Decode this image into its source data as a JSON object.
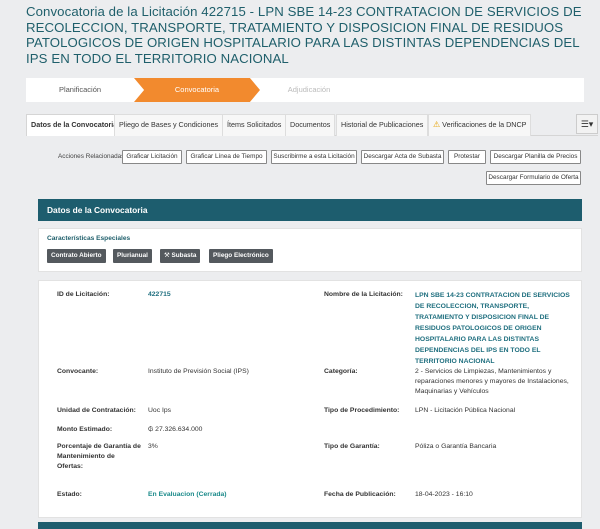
{
  "page": {
    "title": "Convocatoria de la Licitación 422715 - LPN SBE 14-23 CONTRATACION DE SERVICIOS DE RECOLECCION, TRANSPORTE, TRATAMIENTO Y DISPOSICION FINAL DE RESIDUOS PATOLOGICOS DE ORIGEN HOSPITALARIO PARA LAS DISTINTAS DEPENDENCIAS DEL IPS EN TODO EL TERRITORIO NACIONAL"
  },
  "steps": [
    {
      "label": "Planificación"
    },
    {
      "label": "Convocatoria"
    },
    {
      "label": "Adjudicación"
    }
  ],
  "tabs": [
    {
      "label": "Datos de la Convocatoria"
    },
    {
      "label": "Pliego de Bases y Condiciones"
    },
    {
      "label": "Ítems Solicitados"
    },
    {
      "label": "Documentos"
    },
    {
      "label": "Historial de Publicaciones"
    },
    {
      "label": "Verificaciones de la DNCP"
    }
  ],
  "actions": {
    "label": "Acciones Relacionadas:",
    "buttons": [
      "Graficar Licitación",
      "Graficar Línea de Tiempo",
      "Suscribirme a esta Licitación",
      "Descargar Acta de Subasta",
      "Protestar",
      "Descargar Planilla de Precios",
      "Descargar Formulario de Oferta"
    ]
  },
  "section": {
    "title": "Datos de la Convocatoria"
  },
  "especiales": {
    "title": "Características Especiales",
    "badges": [
      "Contrato Abierto",
      "Plurianual",
      "Subasta",
      "Pliego Electrónico"
    ]
  },
  "fields": {
    "id_label": "ID de Licitación:",
    "id_value": "422715",
    "nombre_label": "Nombre de la Licitación:",
    "nombre_value": "LPN SBE 14-23 CONTRATACION DE SERVICIOS DE RECOLECCION, TRANSPORTE, TRATAMIENTO Y DISPOSICION FINAL DE RESIDUOS PATOLOGICOS DE ORIGEN HOSPITALARIO PARA LAS DISTINTAS DEPENDENCIAS DEL IPS EN TODO EL TERRITORIO NACIONAL",
    "convocante_label": "Convocante:",
    "convocante_value": "Instituto de Previsión Social (IPS)",
    "categoria_label": "Categoría:",
    "categoria_value": "2 - Servicios de Limpiezas, Mantenimientos y reparaciones menores y mayores de Instalaciones, Maquinarias y Vehículos",
    "unidad_label": "Unidad de Contratación:",
    "unidad_value": "Uoc Ips",
    "tipo_proc_label": "Tipo de Procedimiento:",
    "tipo_proc_value": "LPN - Licitación Pública Nacional",
    "monto_label": "Monto Estimado:",
    "monto_value": "₲ 27.326.634.000",
    "porcentaje_label": "Porcentaje de Garantía de Mantenimiento de Ofertas:",
    "porcentaje_value": "3%",
    "tipo_gar_label": "Tipo de Garantía:",
    "tipo_gar_value": "Póliza o Garantía Bancaria",
    "estado_label": "Estado:",
    "estado_value": "En Evaluacion (Cerrada)",
    "fecha_label": "Fecha de Publicación:",
    "fecha_value": "18-04-2023 - 16:10"
  },
  "colors": {
    "accent": "#f28a2e",
    "header": "#1d5d6e",
    "link": "#1f6f7f"
  }
}
